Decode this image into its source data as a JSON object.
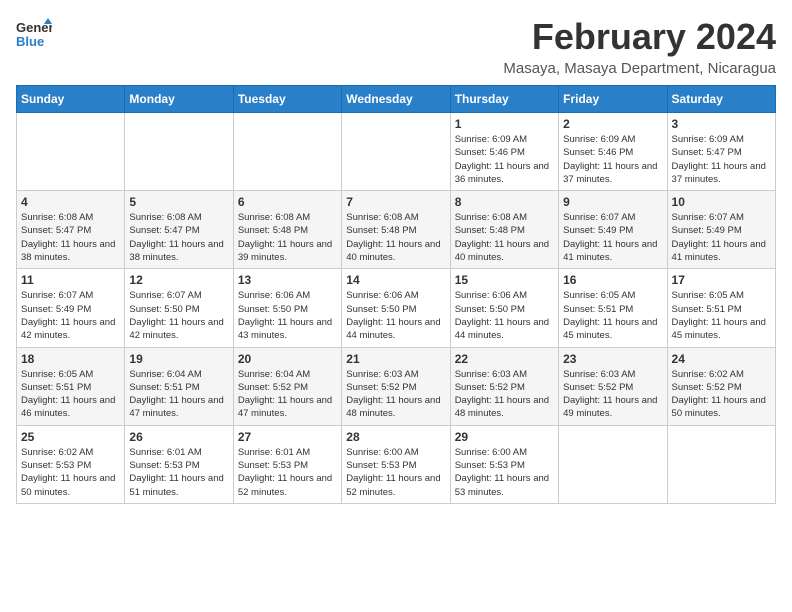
{
  "logo": {
    "text_general": "General",
    "text_blue": "Blue"
  },
  "title": "February 2024",
  "subtitle": "Masaya, Masaya Department, Nicaragua",
  "days_of_week": [
    "Sunday",
    "Monday",
    "Tuesday",
    "Wednesday",
    "Thursday",
    "Friday",
    "Saturday"
  ],
  "weeks": [
    [
      {
        "day": "",
        "info": ""
      },
      {
        "day": "",
        "info": ""
      },
      {
        "day": "",
        "info": ""
      },
      {
        "day": "",
        "info": ""
      },
      {
        "day": "1",
        "info": "Sunrise: 6:09 AM\nSunset: 5:46 PM\nDaylight: 11 hours\nand 36 minutes."
      },
      {
        "day": "2",
        "info": "Sunrise: 6:09 AM\nSunset: 5:46 PM\nDaylight: 11 hours\nand 37 minutes."
      },
      {
        "day": "3",
        "info": "Sunrise: 6:09 AM\nSunset: 5:47 PM\nDaylight: 11 hours\nand 37 minutes."
      }
    ],
    [
      {
        "day": "4",
        "info": "Sunrise: 6:08 AM\nSunset: 5:47 PM\nDaylight: 11 hours\nand 38 minutes."
      },
      {
        "day": "5",
        "info": "Sunrise: 6:08 AM\nSunset: 5:47 PM\nDaylight: 11 hours\nand 38 minutes."
      },
      {
        "day": "6",
        "info": "Sunrise: 6:08 AM\nSunset: 5:48 PM\nDaylight: 11 hours\nand 39 minutes."
      },
      {
        "day": "7",
        "info": "Sunrise: 6:08 AM\nSunset: 5:48 PM\nDaylight: 11 hours\nand 40 minutes."
      },
      {
        "day": "8",
        "info": "Sunrise: 6:08 AM\nSunset: 5:48 PM\nDaylight: 11 hours\nand 40 minutes."
      },
      {
        "day": "9",
        "info": "Sunrise: 6:07 AM\nSunset: 5:49 PM\nDaylight: 11 hours\nand 41 minutes."
      },
      {
        "day": "10",
        "info": "Sunrise: 6:07 AM\nSunset: 5:49 PM\nDaylight: 11 hours\nand 41 minutes."
      }
    ],
    [
      {
        "day": "11",
        "info": "Sunrise: 6:07 AM\nSunset: 5:49 PM\nDaylight: 11 hours\nand 42 minutes."
      },
      {
        "day": "12",
        "info": "Sunrise: 6:07 AM\nSunset: 5:50 PM\nDaylight: 11 hours\nand 42 minutes."
      },
      {
        "day": "13",
        "info": "Sunrise: 6:06 AM\nSunset: 5:50 PM\nDaylight: 11 hours\nand 43 minutes."
      },
      {
        "day": "14",
        "info": "Sunrise: 6:06 AM\nSunset: 5:50 PM\nDaylight: 11 hours\nand 44 minutes."
      },
      {
        "day": "15",
        "info": "Sunrise: 6:06 AM\nSunset: 5:50 PM\nDaylight: 11 hours\nand 44 minutes."
      },
      {
        "day": "16",
        "info": "Sunrise: 6:05 AM\nSunset: 5:51 PM\nDaylight: 11 hours\nand 45 minutes."
      },
      {
        "day": "17",
        "info": "Sunrise: 6:05 AM\nSunset: 5:51 PM\nDaylight: 11 hours\nand 45 minutes."
      }
    ],
    [
      {
        "day": "18",
        "info": "Sunrise: 6:05 AM\nSunset: 5:51 PM\nDaylight: 11 hours\nand 46 minutes."
      },
      {
        "day": "19",
        "info": "Sunrise: 6:04 AM\nSunset: 5:51 PM\nDaylight: 11 hours\nand 47 minutes."
      },
      {
        "day": "20",
        "info": "Sunrise: 6:04 AM\nSunset: 5:52 PM\nDaylight: 11 hours\nand 47 minutes."
      },
      {
        "day": "21",
        "info": "Sunrise: 6:03 AM\nSunset: 5:52 PM\nDaylight: 11 hours\nand 48 minutes."
      },
      {
        "day": "22",
        "info": "Sunrise: 6:03 AM\nSunset: 5:52 PM\nDaylight: 11 hours\nand 48 minutes."
      },
      {
        "day": "23",
        "info": "Sunrise: 6:03 AM\nSunset: 5:52 PM\nDaylight: 11 hours\nand 49 minutes."
      },
      {
        "day": "24",
        "info": "Sunrise: 6:02 AM\nSunset: 5:52 PM\nDaylight: 11 hours\nand 50 minutes."
      }
    ],
    [
      {
        "day": "25",
        "info": "Sunrise: 6:02 AM\nSunset: 5:53 PM\nDaylight: 11 hours\nand 50 minutes."
      },
      {
        "day": "26",
        "info": "Sunrise: 6:01 AM\nSunset: 5:53 PM\nDaylight: 11 hours\nand 51 minutes."
      },
      {
        "day": "27",
        "info": "Sunrise: 6:01 AM\nSunset: 5:53 PM\nDaylight: 11 hours\nand 52 minutes."
      },
      {
        "day": "28",
        "info": "Sunrise: 6:00 AM\nSunset: 5:53 PM\nDaylight: 11 hours\nand 52 minutes."
      },
      {
        "day": "29",
        "info": "Sunrise: 6:00 AM\nSunset: 5:53 PM\nDaylight: 11 hours\nand 53 minutes."
      },
      {
        "day": "",
        "info": ""
      },
      {
        "day": "",
        "info": ""
      }
    ]
  ]
}
